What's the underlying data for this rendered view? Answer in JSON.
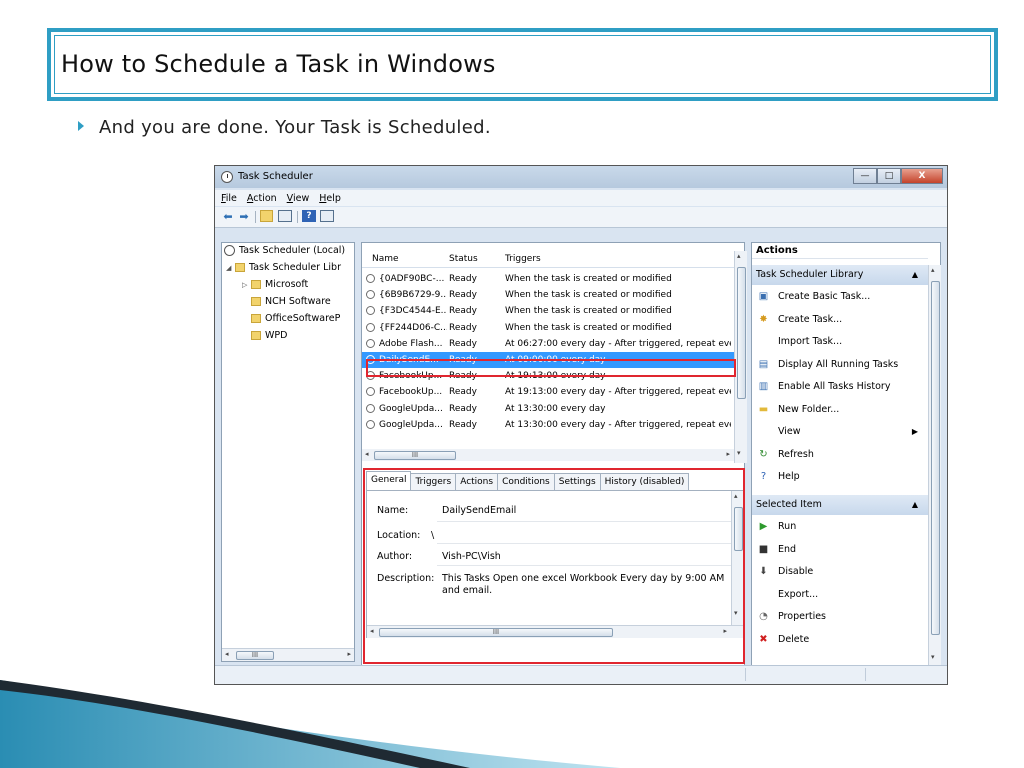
{
  "slide": {
    "title": "How to Schedule a Task in Windows",
    "bullet": "And you are done. Your Task is Scheduled.",
    "accent": "#2f9ec4"
  },
  "window": {
    "title": "Task Scheduler",
    "min_label": "—",
    "max_label": "□",
    "close_label": "X",
    "menu": [
      "File",
      "Action",
      "View",
      "Help"
    ]
  },
  "tree": {
    "root": "Task Scheduler (Local)",
    "library": "Task Scheduler Libr",
    "folders": [
      "Microsoft",
      "NCH Software",
      "OfficeSoftwareP",
      "WPD"
    ],
    "scroll_thumb": "III"
  },
  "task_list": {
    "columns": [
      "Name",
      "Status",
      "Triggers"
    ],
    "rows": [
      {
        "name": "{0ADF90BC-...",
        "status": "Ready",
        "trigger": "When the task is created or modified"
      },
      {
        "name": "{6B9B6729-9...",
        "status": "Ready",
        "trigger": "When the task is created or modified"
      },
      {
        "name": "{F3DC4544-E...",
        "status": "Ready",
        "trigger": "When the task is created or modified"
      },
      {
        "name": "{FF244D06-C...",
        "status": "Ready",
        "trigger": "When the task is created or modified"
      },
      {
        "name": "Adobe Flash...",
        "status": "Ready",
        "trigger": "At 06:27:00 every day - After triggered, repeat ever"
      },
      {
        "name": "DailySendE...",
        "status": "Ready",
        "trigger": "At 09:00:00 every day"
      },
      {
        "name": "FacebookUp...",
        "status": "Ready",
        "trigger": "At 19:13:00 every day"
      },
      {
        "name": "FacebookUp...",
        "status": "Ready",
        "trigger": "At 19:13:00 every day - After triggered, repeat ever"
      },
      {
        "name": "GoogleUpda...",
        "status": "Ready",
        "trigger": "At 13:30:00 every day"
      },
      {
        "name": "GoogleUpda...",
        "status": "Ready",
        "trigger": "At 13:30:00 every day - After triggered, repeat ever"
      }
    ],
    "selected_index": 5,
    "scroll_thumb": "III"
  },
  "details": {
    "tabs": [
      "General",
      "Triggers",
      "Actions",
      "Conditions",
      "Settings",
      "History (disabled)"
    ],
    "active_tab": "General",
    "name_label": "Name:",
    "name_value": "DailySendEmail",
    "location_label": "Location:",
    "location_value": "\\",
    "author_label": "Author:",
    "author_value": "Vish-PC\\Vish",
    "description_label": "Description:",
    "description_value": "This Tasks Open one excel Workbook Every day by 9:00 AM and email.",
    "scroll_thumb": "III"
  },
  "actions": {
    "header": "Actions",
    "section1": "Task Scheduler Library",
    "items1": [
      {
        "label": "Create Basic Task...",
        "icon": "create-basic-task-icon"
      },
      {
        "label": "Create Task...",
        "icon": "create-task-icon"
      },
      {
        "label": "Import Task...",
        "icon": ""
      },
      {
        "label": "Display All Running Tasks",
        "icon": "running-tasks-icon"
      },
      {
        "label": "Enable All Tasks History",
        "icon": "history-icon"
      },
      {
        "label": "New Folder...",
        "icon": "folder-icon"
      },
      {
        "label": "View",
        "icon": ""
      },
      {
        "label": "Refresh",
        "icon": "refresh-icon"
      },
      {
        "label": "Help",
        "icon": "help-icon"
      }
    ],
    "section2": "Selected Item",
    "items2": [
      {
        "label": "Run",
        "icon": "run-icon"
      },
      {
        "label": "End",
        "icon": "end-icon"
      },
      {
        "label": "Disable",
        "icon": "disable-icon"
      },
      {
        "label": "Export...",
        "icon": ""
      },
      {
        "label": "Properties",
        "icon": "properties-icon"
      },
      {
        "label": "Delete",
        "icon": "delete-icon"
      }
    ]
  },
  "colors": {
    "selection": "#3399ff",
    "highlight_box": "#e0262f",
    "window_frame": "#d9e4f1"
  }
}
